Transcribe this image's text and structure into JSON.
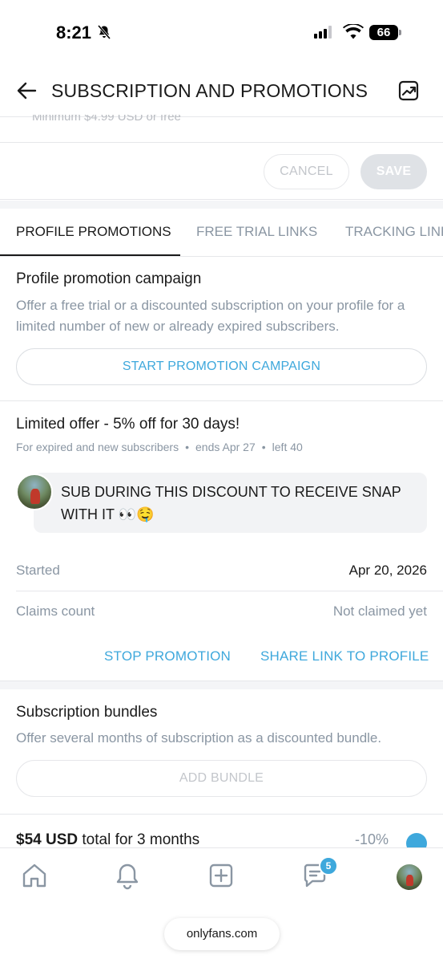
{
  "status_bar": {
    "time": "8:21",
    "battery": "66"
  },
  "header": {
    "title": "SUBSCRIPTION AND PROMOTIONS"
  },
  "cutoff_text": "Minimum $4.99 USD or free",
  "save_row": {
    "cancel_label": "CANCEL",
    "save_label": "SAVE"
  },
  "tabs": [
    {
      "label": "PROFILE PROMOTIONS",
      "active": true
    },
    {
      "label": "FREE TRIAL LINKS",
      "active": false
    },
    {
      "label": "TRACKING LINKS",
      "active": false
    }
  ],
  "promotion_campaign": {
    "title": "Profile promotion campaign",
    "description": "Offer a free trial or a discounted subscription on your profile for a limited number of new or already expired subscribers.",
    "button_label": "START PROMOTION CAMPAIGN"
  },
  "active_offer": {
    "title": "Limited offer - 5% off for 30 days!",
    "audience": "For expired and new subscribers",
    "ends": "ends Apr 27",
    "left": "left 40",
    "message": "SUB DURING THIS DISCOUNT TO RECEIVE SNAP WITH IT 👀🤤",
    "started_label": "Started",
    "started_value": "Apr 20, 2026",
    "claims_label": "Claims count",
    "claims_value": "Not claimed yet",
    "stop_label": "STOP PROMOTION",
    "share_label": "SHARE LINK TO PROFILE"
  },
  "bundles": {
    "title": "Subscription bundles",
    "description": "Offer several months of subscription as a discounted bundle.",
    "add_label": "ADD BUNDLE",
    "items": [
      {
        "price": "$54 USD",
        "term": "total for 3 months",
        "discount": "-10%"
      }
    ]
  },
  "bottom_nav": {
    "messages_badge": "5",
    "url": "onlyfans.com"
  },
  "colors": {
    "accent": "#3ea8dc",
    "muted": "#8a96a3",
    "divider": "#e6e7ea"
  }
}
